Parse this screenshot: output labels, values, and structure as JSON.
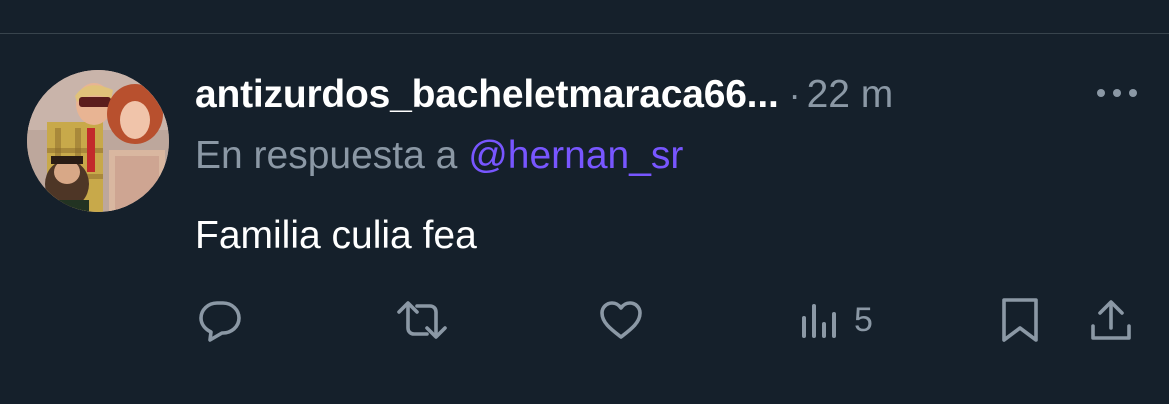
{
  "tweet": {
    "username": "antizurdos_bacheletmaraca66...",
    "separator": "·",
    "time": "22 m",
    "reply_prefix": "En respuesta a",
    "reply_handle": "@hernan_sr",
    "text": "Familia culia fea"
  },
  "actions": {
    "reply_icon": "comment-bubble-icon",
    "retweet_icon": "retweet-icon",
    "like_icon": "heart-icon",
    "views_icon": "bar-chart-icon",
    "views_count": "5",
    "bookmark_icon": "bookmark-icon",
    "share_icon": "share-upload-icon"
  },
  "colors": {
    "background": "#15202b",
    "primary_text": "#ffffff",
    "secondary_text": "#8b98a5",
    "mention": "#7856ff",
    "divider": "#38444d"
  }
}
